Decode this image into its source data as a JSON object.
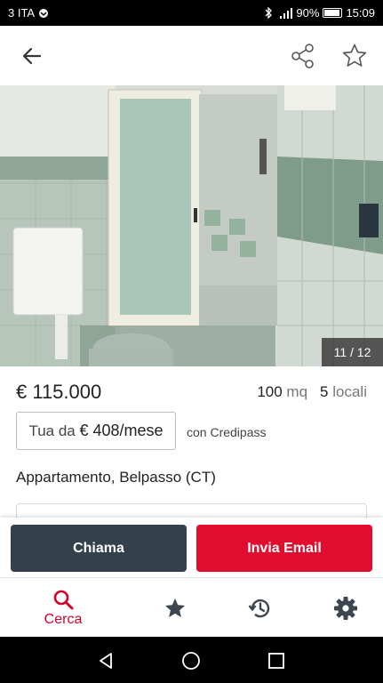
{
  "status_bar": {
    "carrier": "3 ITA",
    "battery": "90%",
    "battery_level": 0.9,
    "time": "15:09"
  },
  "header": {
    "back_icon": "arrow-back-icon",
    "share_icon": "share-icon",
    "favorite_icon": "star-outline-icon"
  },
  "gallery": {
    "counter": "11 / 12"
  },
  "listing": {
    "price": "€ 115.000",
    "area_value": "100",
    "area_unit": "mq",
    "rooms_value": "5",
    "rooms_unit": "locali",
    "credit_prefix": "Tua da",
    "credit_amount": "€ 408/mese",
    "credit_note": "con Credipass",
    "title": "Appartamento, Belpasso (CT)"
  },
  "actions": {
    "call_label": "Chiama",
    "email_label": "Invia Email",
    "call_color": "#34404b",
    "email_color": "#e20d2e"
  },
  "tabs": [
    {
      "icon": "search-icon",
      "label": "Cerca",
      "active": true
    },
    {
      "icon": "star-icon"
    },
    {
      "icon": "history-icon"
    },
    {
      "icon": "gear-icon"
    }
  ],
  "accent_color": "#d6002a"
}
